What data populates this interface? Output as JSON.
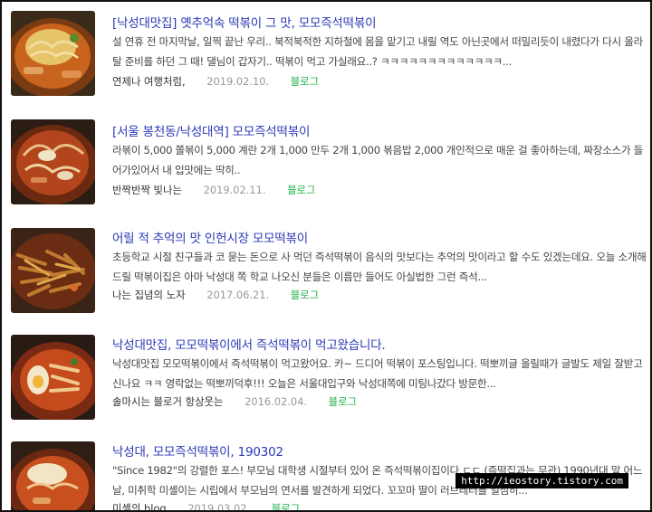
{
  "results": [
    {
      "title": "[낙성대맛집] 옛추억속 떡볶이 그 맛, 모모즉석떡볶이",
      "desc": "설 연휴 전 마지막날, 일찍 끝난 우리.. 북적북적한 지하철에 몸을 맡기고 내릴 역도 아닌곳에서 떠밀리듯이 내렸다가 다시 올라탈 준비를 하던 그 때! 댈님이 갑자기.. 떡볶이 먹고 가실래요..? ㅋㅋㅋㅋㅋㅋㅋㅋㅋㅋㅋㅋㅋ...",
      "author": "연제나 여행처럼,",
      "date": "2019.02.10.",
      "source": "블로그"
    },
    {
      "title": "[서울 봉천동/낙성대역] 모모즉석떡볶이",
      "desc": "라볶이 5,000 쫄볶이 5,000 계란 2개 1,000 만두 2개 1,000 볶음밥 2,000 개인적으로 매운 걸 좋아하는데, 짜장소스가 들어가있어서 내 입맛에는 딱히..",
      "author": "반짝반짝 빛나는",
      "date": "2019.02.11.",
      "source": "블로그"
    },
    {
      "title": "어릴 적 추억의 맛 인헌시장 모모떡볶이",
      "desc": "초등학교 시절 친구들과 코 묻는 돈으로 사 먹던 즉석떡볶이 음식의 맛보다는 추억의 맛이라고 할 수도 있겠는데요. 오늘 소개해드릴 떡볶이집은 아마 낙성대 쪽 학교 나오신 분들은 이름만 들어도 아실법한 그런 즉석...",
      "author": "나는 집념의 노자",
      "date": "2017.06.21.",
      "source": "블로그"
    },
    {
      "title": "낙성대맛집, 모모떡볶이에서 즉석떡볶이 먹고왔습니다.",
      "desc": "낙성대맛집 모모떡볶이에서 즉석떡볶이 먹고왔어요. 카~ 드디어 떡볶이 포스팅입니다. 떡뽀끼글 올릴때가 글발도 제일 잘받고 신나요 ㅋㅋ 영락없는 떡뽀끼덕후!!! 오늘은 서울대입구와 낙성대쪽에 미팅나갔다 방문한...",
      "author": "솔마시는 블로거 항상웃는",
      "date": "2016.02.04.",
      "source": "블로그"
    },
    {
      "title": "낙성대, 모모즉석떡볶이, 190302",
      "desc": "\"Since 1982\"의 강렬한 포스! 부모님 대학생 시절부터 있어 온 즉석떡볶이집이다.ㄷㄷ (즉떡집과는 무관) 1990년대 말 어느 날, 미취학 미셸이는 시립에서 부모님의 연서를 발견하게 되었다. 꼬꼬마 딸이 러브레터를 일심히...",
      "author": "미셸의 blog",
      "date": "2019.03.02.",
      "source": "블로그"
    }
  ],
  "watermark": "http://ieostory.tistory.com"
}
